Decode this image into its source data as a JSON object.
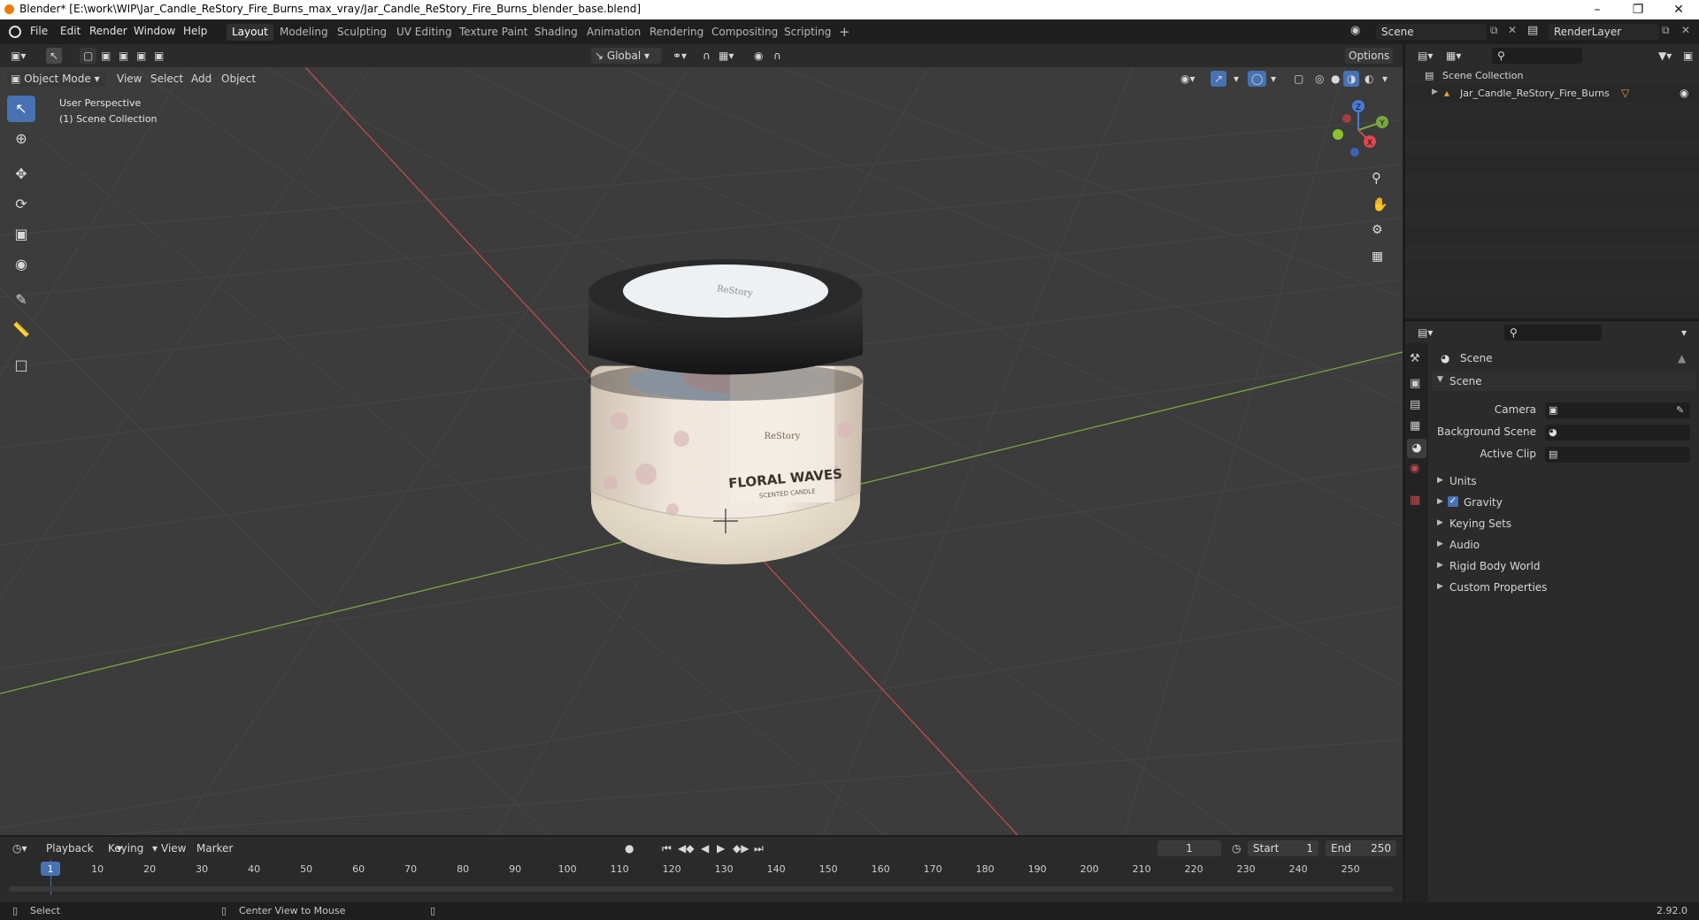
{
  "window": {
    "title": "Blender* [E:\\work\\WIP\\Jar_Candle_ReStory_Fire_Burns_max_vray/Jar_Candle_ReStory_Fire_Burns_blender_base.blend]",
    "minimize": "–",
    "maximize": "❐",
    "close": "✕"
  },
  "menubar": {
    "items": [
      "File",
      "Edit",
      "Render",
      "Window",
      "Help"
    ],
    "workspaces": [
      "Layout",
      "Modeling",
      "Sculpting",
      "UV Editing",
      "Texture Paint",
      "Shading",
      "Animation",
      "Rendering",
      "Compositing",
      "Scripting"
    ],
    "add_workspace": "+",
    "scene_name": "Scene",
    "view_layer": "RenderLayer"
  },
  "viewport_header": {
    "mode": "Object Mode",
    "menus": [
      "View",
      "Select",
      "Add",
      "Object"
    ],
    "orientation": "Global",
    "options": "Options"
  },
  "viewport": {
    "view_name": "User Perspective",
    "collection_info": "(1) Scene Collection",
    "gizmo_axes": [
      "Z",
      "Y",
      "X"
    ],
    "label_brand": "ReStory",
    "label_title": "FLORAL WAVES",
    "label_subtitle": "SCENTED CANDLE"
  },
  "outliner": {
    "root": "Scene Collection",
    "items": [
      {
        "name": "Jar_Candle_ReStory_Fire_Burns"
      }
    ]
  },
  "properties": {
    "context": "Scene",
    "panel": "Scene",
    "fields": [
      {
        "label": "Camera"
      },
      {
        "label": "Background Scene"
      },
      {
        "label": "Active Clip"
      }
    ],
    "subpanels": [
      "Units",
      "Gravity",
      "Keying Sets",
      "Audio",
      "Rigid Body World",
      "Custom Properties"
    ],
    "gravity_checked": true
  },
  "timeline": {
    "menus": [
      "Playback",
      "Keying",
      "View",
      "Marker"
    ],
    "current_frame": "1",
    "start_label": "Start",
    "start": "1",
    "end_label": "End",
    "end": "250",
    "ruler_marks": [
      "1",
      "10",
      "20",
      "30",
      "40",
      "50",
      "60",
      "70",
      "80",
      "90",
      "100",
      "110",
      "120",
      "130",
      "140",
      "150",
      "160",
      "170",
      "180",
      "190",
      "200",
      "210",
      "220",
      "230",
      "240",
      "250"
    ]
  },
  "statusbar": {
    "left_hint": "Select",
    "mid_hint": "Center View to Mouse",
    "version": "2.92.0"
  },
  "colors": {
    "accent": "#4772b3",
    "x_axis": "#c04a50",
    "y_axis": "#7aa640",
    "viewport_bg": "#3c3c3c"
  }
}
